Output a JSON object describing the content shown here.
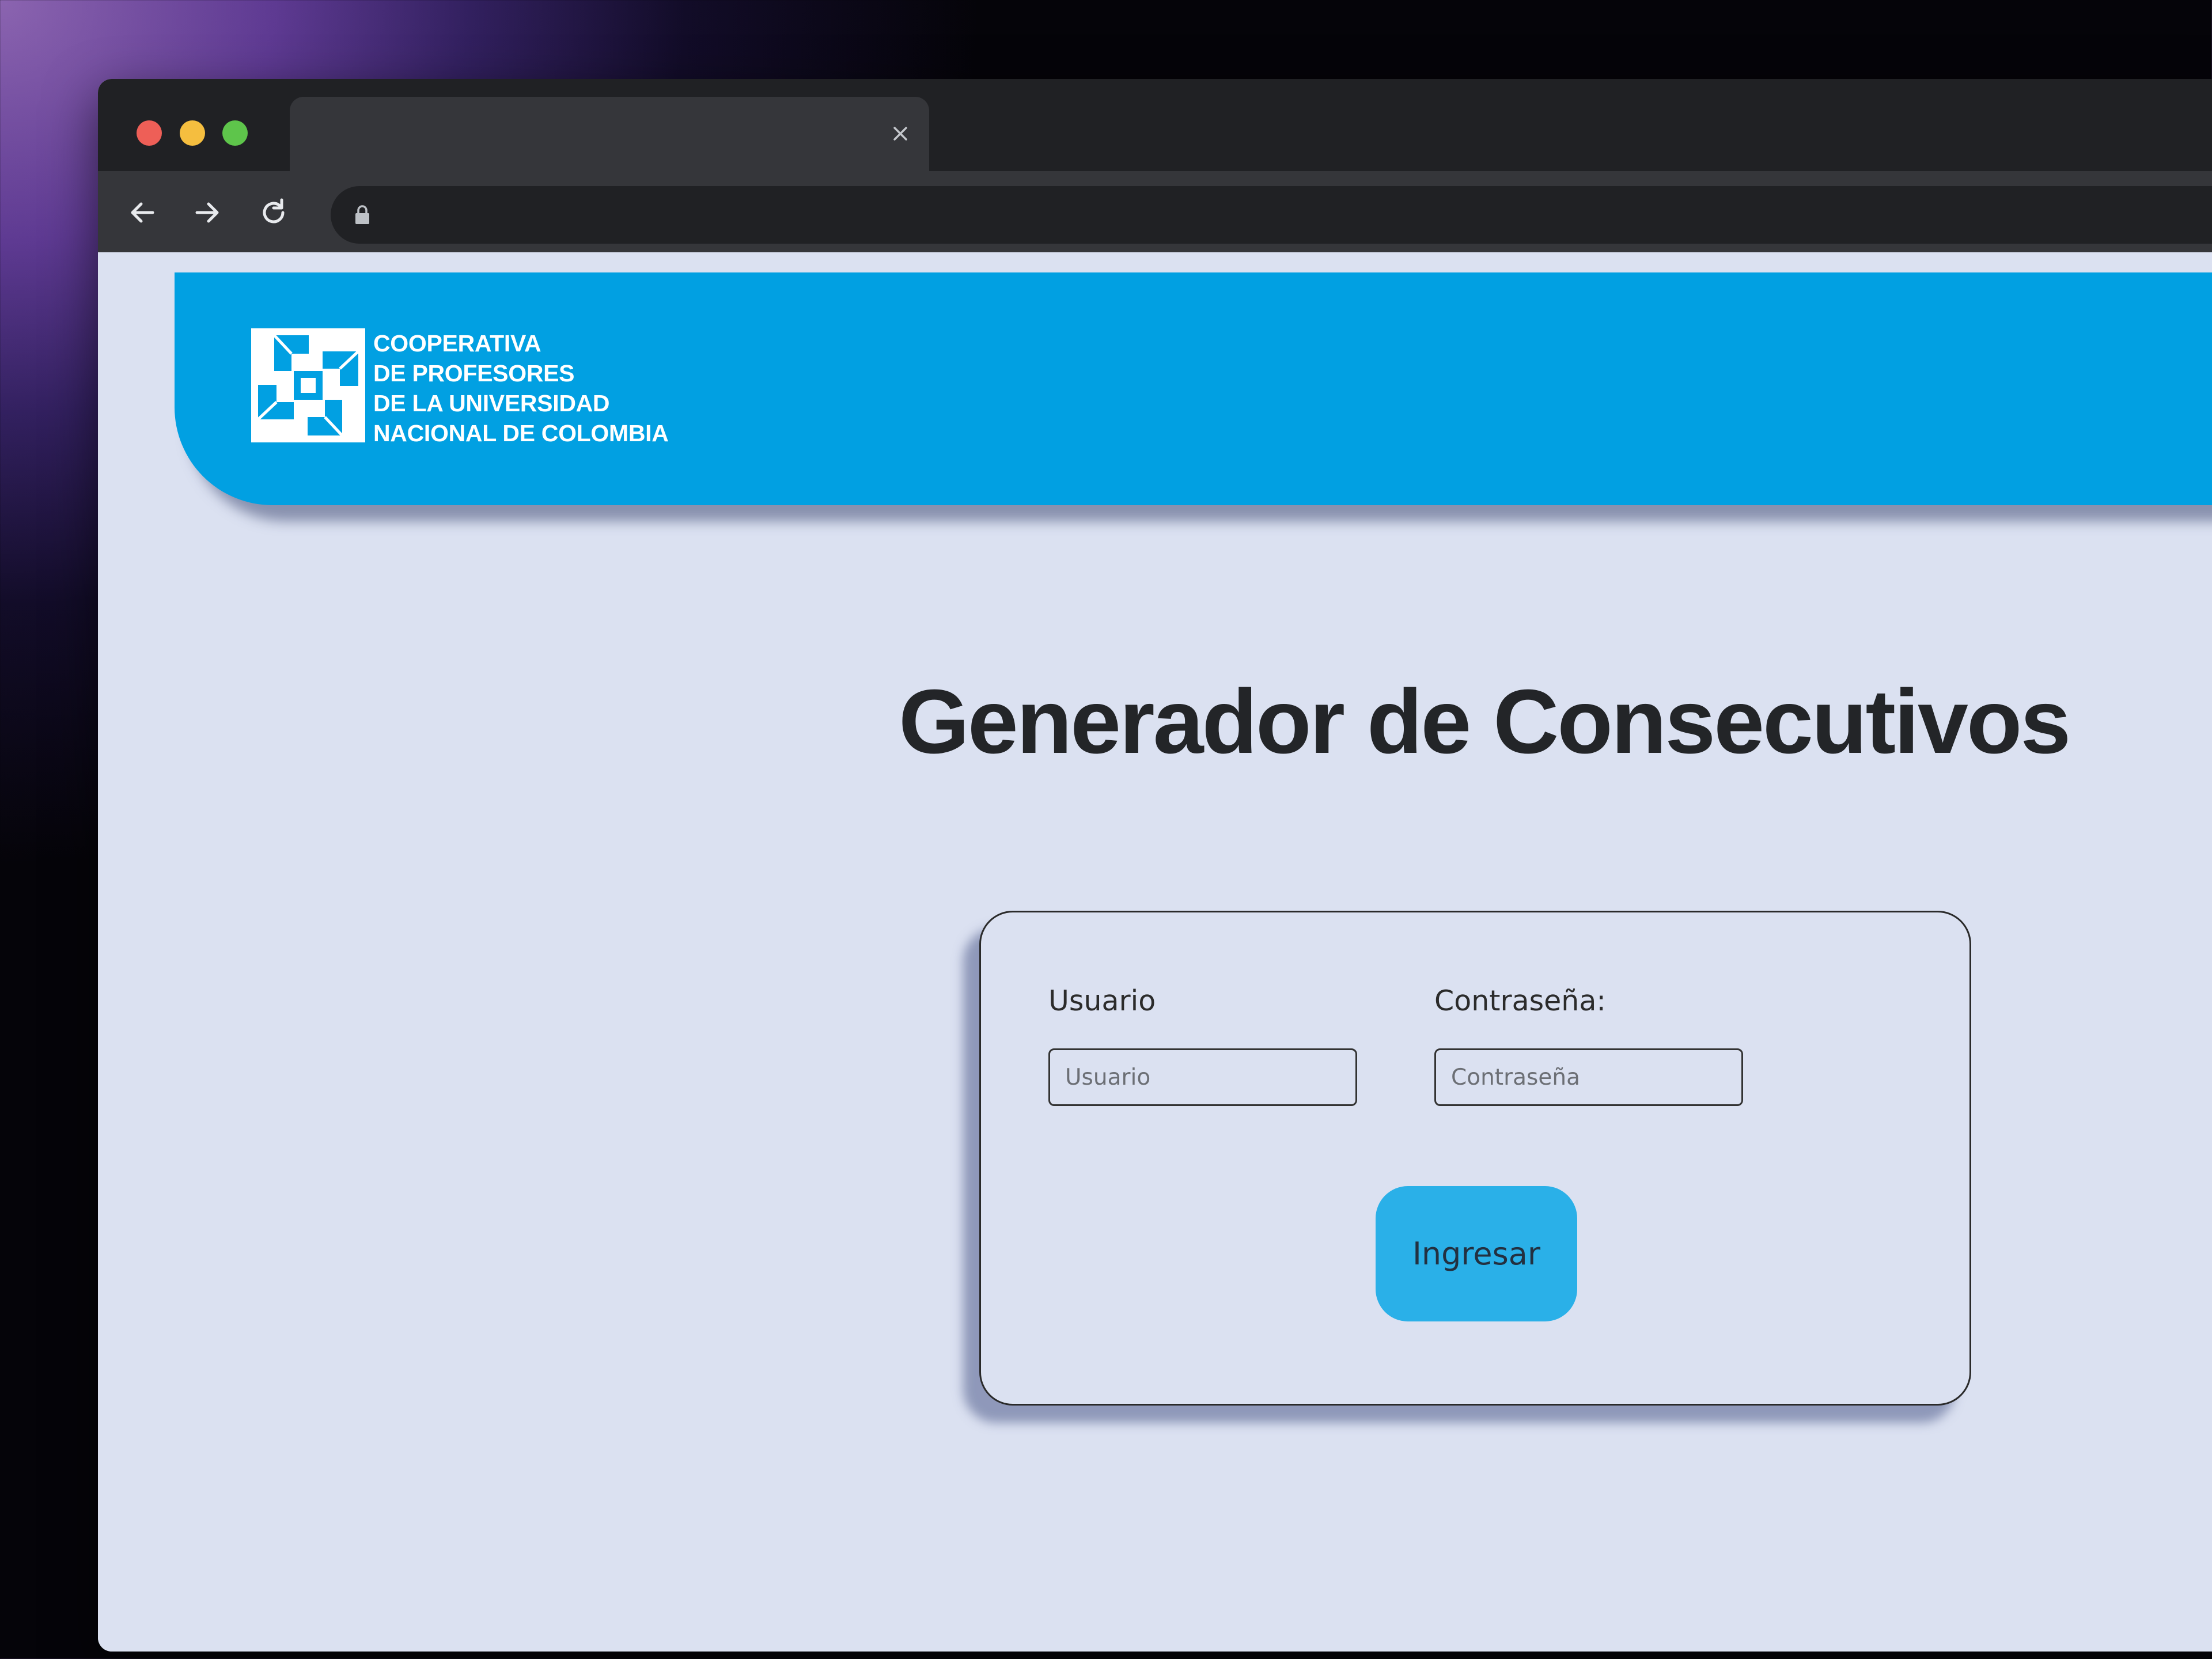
{
  "browser": {
    "tab_title": "",
    "url": "",
    "icons": {
      "close": "close-icon",
      "back": "arrow-left-icon",
      "forward": "arrow-right-icon",
      "reload": "reload-icon",
      "lock": "lock-icon"
    }
  },
  "header": {
    "logo_lines": [
      "COOPERATIVA",
      "DE PROFESORES",
      "DE LA UNIVERSIDAD",
      "NACIONAL DE COLOMBIA"
    ],
    "background_color": "#01a0e2"
  },
  "page": {
    "title": "Generador de Consecutivos"
  },
  "login": {
    "user_label": "Usuario",
    "user_placeholder": "Usuario",
    "user_value": "",
    "password_label": "Contraseña:",
    "password_placeholder": "Contraseña",
    "password_value": "",
    "submit_label": "Ingresar",
    "button_color": "#2ab0e8"
  }
}
